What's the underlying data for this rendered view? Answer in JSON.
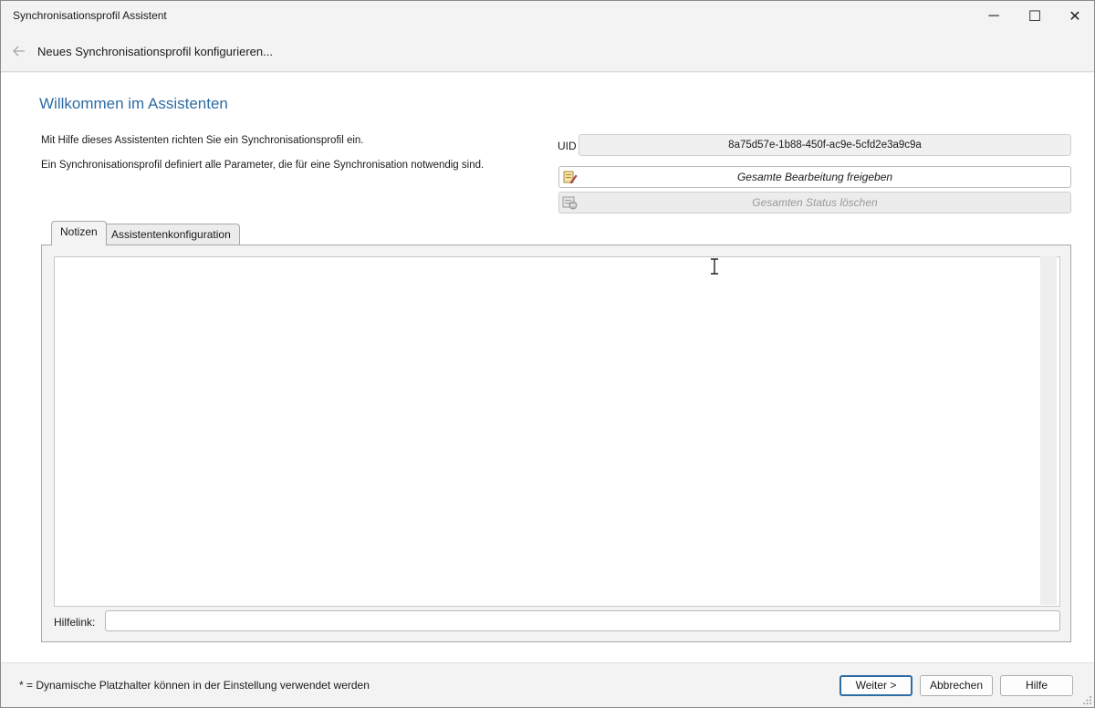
{
  "window": {
    "title": "Synchronisationsprofil Assistent",
    "controls": {
      "minimize": "─",
      "maximize": "☐",
      "close": "✕"
    }
  },
  "nav": {
    "back_icon": "arrow-left-icon",
    "heading": "Neues Synchronisationsprofil konfigurieren..."
  },
  "main": {
    "welcome_title": "Willkommen im Assistenten",
    "description_line1": "Mit Hilfe dieses Assistenten richten Sie ein Synchronisationsprofil ein.",
    "description_line2": "Ein Synchronisationsprofil definiert alle Parameter, die für eine Synchronisation notwendig sind.",
    "uid_label": "UID",
    "uid_value": "8a75d57e-1b88-450f-ac9e-5cfd2e3a9c9a",
    "release_button": "Gesamte Bearbeitung freigeben",
    "clear_status_button": "Gesamten Status löschen"
  },
  "tabs": [
    {
      "label": "Notizen",
      "active": true
    },
    {
      "label": "Assistentenkonfiguration",
      "active": false
    }
  ],
  "notes": {
    "text": "",
    "help_link_label": "Hilfelink:",
    "help_link_value": ""
  },
  "footer": {
    "footnote": "* = Dynamische Platzhalter können in der Einstellung verwendet werden",
    "next_button": "Weiter >",
    "cancel_button": "Abbrechen",
    "help_button": "Hilfe"
  },
  "colors": {
    "accent": "#2e6ca4",
    "disabled_text": "#9a9a9a",
    "window_bg": "#f3f3f3"
  }
}
